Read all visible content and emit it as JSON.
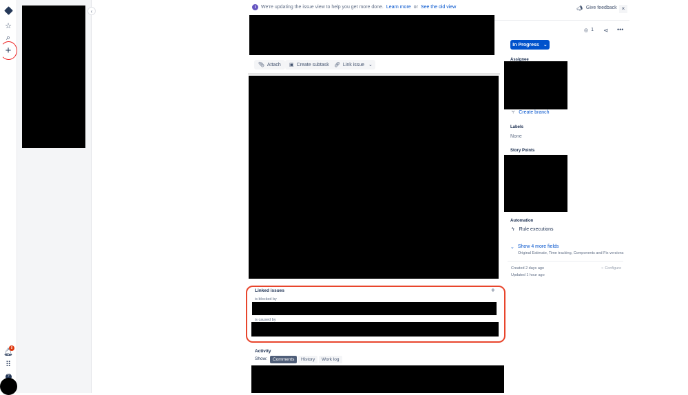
{
  "rail": {
    "notification_count": "8"
  },
  "banner": {
    "text": "We're updating the issue view to help you get more done.",
    "learn_more": "Learn more",
    "or": "or",
    "old_view": "See the old view",
    "feedback": "Give feedback"
  },
  "toolbar": {
    "attach": "Attach",
    "create_subtask": "Create subtask",
    "link_issue": "Link issue"
  },
  "header": {
    "watchers": "1"
  },
  "details": {
    "status": "In Progress",
    "assignee_label": "Assignee",
    "create_branch": "Create branch",
    "labels_label": "Labels",
    "labels_value": "None",
    "story_points_label": "Story Points",
    "automation_label": "Automation",
    "rule_executions": "Rule executions",
    "show_more": "Show 4 more fields",
    "show_more_sub": "Original Estimate, Time tracking, Components and Fix versions",
    "created": "Created 2 days ago",
    "updated": "Updated 1 hour ago",
    "configure": "Configure"
  },
  "linked": {
    "title": "Linked issues",
    "blocked_by": "is blocked by",
    "caused_by": "is caused by"
  },
  "activity": {
    "title": "Activity",
    "show": "Show:",
    "tabs": [
      "Comments",
      "History",
      "Work log"
    ]
  }
}
